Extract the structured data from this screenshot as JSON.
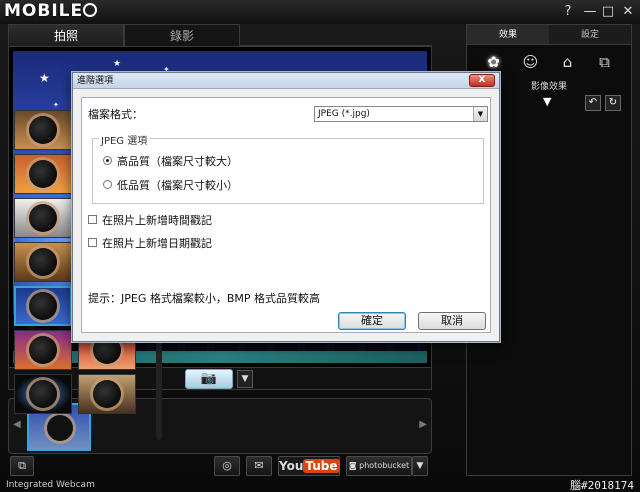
{
  "titlebar": {
    "logo_text": "MOBILE",
    "help": "?",
    "minimize": "—",
    "maximize": "□",
    "close": "✕"
  },
  "tabs": [
    {
      "label": "拍照",
      "active": true
    },
    {
      "label": "錄影",
      "active": false
    }
  ],
  "right_panel": {
    "tabs": [
      {
        "label": "效果",
        "active": true
      },
      {
        "label": "設定",
        "active": false
      }
    ],
    "section_label": "影像效果",
    "effects_count": 14
  },
  "dialog": {
    "title": "進階選項",
    "close": "X",
    "format_label": "檔案格式：",
    "format_value": "JPEG (*.jpg)",
    "group_title": "JPEG 選項",
    "high_quality": "高品質（檔案尺寸較大）",
    "low_quality": "低品質（檔案尺寸較小）",
    "timestamp_time": "在照片上新增時間戳記",
    "timestamp_date": "在照片上新增日期戳記",
    "hint": "提示：JPEG 格式檔案較小，BMP 格式品質較高",
    "ok": "確定",
    "cancel": "取消"
  },
  "bottom": {
    "youtube_you": "You",
    "youtube_tube": "Tube",
    "photobucket": "photobucket"
  },
  "status": "Integrated Webcam",
  "watermark": "腦#2018174",
  "colors": {
    "accent": "#3aa0e0",
    "dialog_bg": "#f0f0f0",
    "close_red": "#c03020"
  }
}
